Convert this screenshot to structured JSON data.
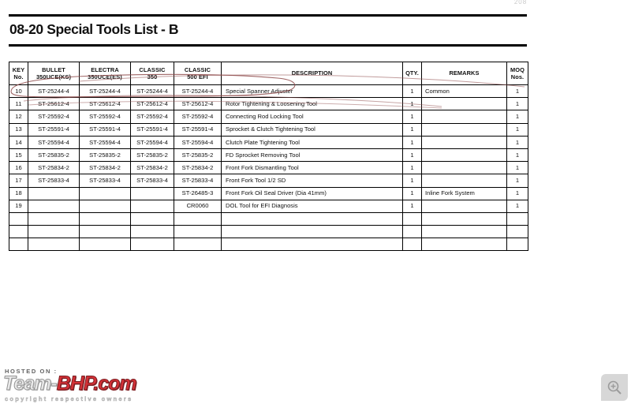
{
  "page": {
    "page_number": "208"
  },
  "document": {
    "title": "08-20 Special Tools List - B"
  },
  "table": {
    "headers": [
      {
        "line1": "KEY",
        "line2": "No."
      },
      {
        "line1": "BULLET",
        "line2": "350UCE(KS)"
      },
      {
        "line1": "ELECTRA",
        "line2": "350UCE(ES)"
      },
      {
        "line1": "CLASSIC",
        "line2": "350"
      },
      {
        "line1": "CLASSIC",
        "line2": "500 EFI"
      },
      {
        "line1": "DESCRIPTION",
        "line2": ""
      },
      {
        "line1": "QTY.",
        "line2": ""
      },
      {
        "line1": "REMARKS",
        "line2": ""
      },
      {
        "line1": "MOQ",
        "line2": "Nos."
      }
    ],
    "rows": [
      {
        "key": "10",
        "bullet": "ST-25244-4",
        "electra": "ST-25244-4",
        "classic350": "ST-25244-4",
        "classic500": "ST-25244-4",
        "description": "Special Spanner Adjuster",
        "qty": "1",
        "remarks": "Common",
        "moq": "1"
      },
      {
        "key": "11",
        "bullet": "ST-25612-4",
        "electra": "ST-25612-4",
        "classic350": "ST-25612-4",
        "classic500": "ST-25612-4",
        "description": "Rotor Tightening & Loosening Tool",
        "qty": "1",
        "remarks": "",
        "moq": "1"
      },
      {
        "key": "12",
        "bullet": "ST-25592-4",
        "electra": "ST-25592-4",
        "classic350": "ST-25592-4",
        "classic500": "ST-25592-4",
        "description": "Connecting Rod Locking Tool",
        "qty": "1",
        "remarks": "",
        "moq": "1"
      },
      {
        "key": "13",
        "bullet": "ST-25591-4",
        "electra": "ST-25591-4",
        "classic350": "ST-25591-4",
        "classic500": "ST-25591-4",
        "description": "Sprocket & Clutch Tightening Tool",
        "qty": "1",
        "remarks": "",
        "moq": "1"
      },
      {
        "key": "14",
        "bullet": "ST-25594-4",
        "electra": "ST-25594-4",
        "classic350": "ST-25594-4",
        "classic500": "ST-25594-4",
        "description": "Clutch Plate Tightening Tool",
        "qty": "1",
        "remarks": "",
        "moq": "1"
      },
      {
        "key": "15",
        "bullet": "ST-25835-2",
        "electra": "ST-25835-2",
        "classic350": "ST-25835-2",
        "classic500": "ST-25835-2",
        "description": "FD Sprocket Removing Tool",
        "qty": "1",
        "remarks": "",
        "moq": "1"
      },
      {
        "key": "16",
        "bullet": "ST-25834-2",
        "electra": "ST-25834-2",
        "classic350": "ST-25834-2",
        "classic500": "ST-25834-2",
        "description": "Front Fork Dismantling Tool",
        "qty": "1",
        "remarks": "",
        "moq": "1"
      },
      {
        "key": "17",
        "bullet": "ST-25833-4",
        "electra": "ST-25833-4",
        "classic350": "ST-25833-4",
        "classic500": "ST-25833-4",
        "description": "Front Fork Tool 1/2 SD",
        "qty": "1",
        "remarks": "",
        "moq": "1"
      },
      {
        "key": "18",
        "bullet": "",
        "electra": "",
        "classic350": "",
        "classic500": "ST-26485-3",
        "description": "Front Fork Oil Seal Driver (Dia 41mm)",
        "qty": "1",
        "remarks": "Inline Fork System",
        "moq": "1"
      },
      {
        "key": "19",
        "bullet": "",
        "electra": "",
        "classic350": "",
        "classic500": "CR0060",
        "description": "DOL Tool for EFI Diagnosis",
        "qty": "1",
        "remarks": "",
        "moq": "1"
      },
      {
        "key": "",
        "bullet": "",
        "electra": "",
        "classic350": "",
        "classic500": "",
        "description": "",
        "qty": "",
        "remarks": "",
        "moq": ""
      },
      {
        "key": "",
        "bullet": "",
        "electra": "",
        "classic350": "",
        "classic500": "",
        "description": "",
        "qty": "",
        "remarks": "",
        "moq": ""
      },
      {
        "key": "",
        "bullet": "",
        "electra": "",
        "classic350": "",
        "classic500": "",
        "description": "",
        "qty": "",
        "remarks": "",
        "moq": ""
      }
    ]
  },
  "annotation": {
    "color": "#8e4a4a",
    "description": "hand-drawn ellipse highlighting row 10"
  },
  "watermark": {
    "hosted_label": "HOSTED ON :",
    "brand_part1": "Team-",
    "brand_part2": "BHP.com",
    "copyright": "copyright respective owners",
    "brand_color": "#d31f26"
  },
  "controls": {
    "zoom_icon": "zoom-in-icon"
  }
}
